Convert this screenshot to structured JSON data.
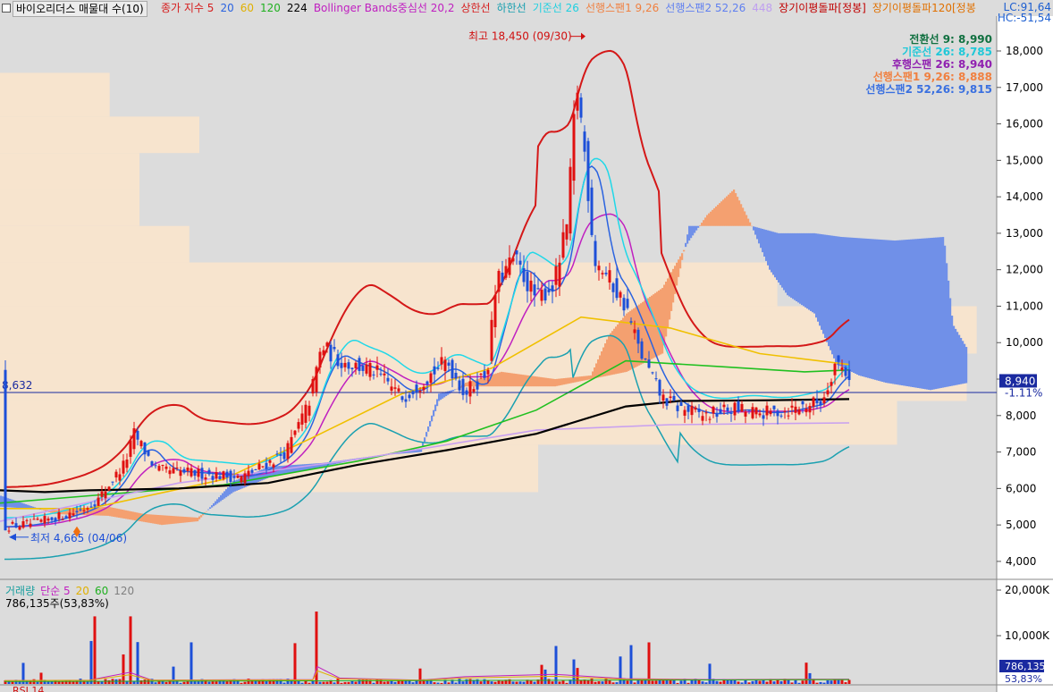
{
  "header": {
    "title": "바이오리더스 매물대 수(10)",
    "legend": [
      {
        "label": "종가 지수 5",
        "color": "#d62020"
      },
      {
        "label": "20",
        "color": "#2a63e0"
      },
      {
        "label": "60",
        "color": "#e0b000"
      },
      {
        "label": "120",
        "color": "#20b020"
      },
      {
        "label": "224",
        "color": "#000000"
      },
      {
        "label": "Bollinger Bands중심선 20,2",
        "color": "#c020c0"
      },
      {
        "label": "상한선",
        "color": "#d62020"
      },
      {
        "label": "하한선",
        "color": "#1aa0b0"
      },
      {
        "label": "기준선 26",
        "color": "#20d0e0"
      },
      {
        "label": "선행스팬1 9,26",
        "color": "#f08040"
      },
      {
        "label": "선행스팬2 52,26",
        "color": "#6080f0"
      },
      {
        "label": "448",
        "color": "#c0a0f0"
      },
      {
        "label": "장기이평돌파[정봉]",
        "color": "#c00000"
      },
      {
        "label": "장기이평돌파120[정봉",
        "color": "#e07000"
      }
    ],
    "lc": "LC:91,64",
    "hc": "HC:-51,54"
  },
  "ichimoku_readout": [
    {
      "label": "전환선 9: 8,990",
      "color": "#107040"
    },
    {
      "label": "기준선 26: 8,785",
      "color": "#20c8d8"
    },
    {
      "label": "후행스팬 26: 8,940",
      "color": "#9020b0"
    },
    {
      "label": "선행스팬1 9,26: 8,888",
      "color": "#f08040"
    },
    {
      "label": "선행스팬2 52,26: 9,815",
      "color": "#3a70e0"
    }
  ],
  "annotations": {
    "high": "최고 18,450 (09/30)",
    "low": "최저 4,665 (04/06)",
    "ref_level_label": "8,632",
    "price_tag": "8,940",
    "change_tag": "-1.11%"
  },
  "volume_panel": {
    "legend": [
      {
        "label": "거래량",
        "color": "#1a9f9f"
      },
      {
        "label": "단순 5",
        "color": "#c020c0"
      },
      {
        "label": "20",
        "color": "#e0b000"
      },
      {
        "label": "60",
        "color": "#20b020"
      },
      {
        "label": "120",
        "color": "#808080"
      }
    ],
    "readout": "786,135주(53,83%)",
    "tag_value": "786,135",
    "tag_pct": "53,83%",
    "ticks": [
      "20,000K",
      "10,000K"
    ]
  },
  "rsi_label": "RSI 14",
  "colors": {
    "up": "#e01010",
    "down": "#1d4fd8",
    "background": "#dcdcdc"
  },
  "chart_data": {
    "type": "candlestick",
    "y_ticks": [
      "18,000",
      "17,000",
      "16,000",
      "15,000",
      "14,000",
      "13,000",
      "12,000",
      "11,000",
      "10,000",
      "9,000",
      "8,000",
      "7,000",
      "6,000",
      "5,000",
      "4,000"
    ],
    "ylim": [
      3600,
      18900
    ],
    "ref_level": 8632,
    "last_close": 8940,
    "volume_profile": [
      {
        "lo": 4700,
        "hi": 5700,
        "w": 0.0
      },
      {
        "lo": 5900,
        "hi": 7200,
        "w": 0.54
      },
      {
        "lo": 7200,
        "hi": 8400,
        "w": 0.9
      },
      {
        "lo": 8400,
        "hi": 9700,
        "w": 0.97
      },
      {
        "lo": 9700,
        "hi": 11000,
        "w": 0.98
      },
      {
        "lo": 11000,
        "hi": 12200,
        "w": 0.78
      },
      {
        "lo": 12200,
        "hi": 13200,
        "w": 0.19
      },
      {
        "lo": 13200,
        "hi": 14200,
        "w": 0.14
      },
      {
        "lo": 14200,
        "hi": 15200,
        "w": 0.14
      },
      {
        "lo": 15200,
        "hi": 16200,
        "w": 0.2
      },
      {
        "lo": 16200,
        "hi": 17400,
        "w": 0.11
      }
    ],
    "series_anchor_points": {
      "ma224": [
        [
          0,
          5950
        ],
        [
          50,
          5900
        ],
        [
          100,
          5950
        ],
        [
          200,
          6000
        ],
        [
          300,
          6150
        ],
        [
          400,
          6650
        ],
        [
          500,
          7050
        ],
        [
          600,
          7500
        ],
        [
          700,
          8250
        ],
        [
          760,
          8400
        ],
        [
          860,
          8420
        ],
        [
          950,
          8450
        ]
      ],
      "ma120": [
        [
          0,
          5600
        ],
        [
          100,
          5800
        ],
        [
          250,
          6100
        ],
        [
          400,
          6750
        ],
        [
          500,
          7300
        ],
        [
          600,
          8150
        ],
        [
          700,
          9500
        ],
        [
          800,
          9350
        ],
        [
          900,
          9200
        ],
        [
          950,
          9250
        ]
      ],
      "ma60": [
        [
          0,
          5450
        ],
        [
          100,
          5450
        ],
        [
          250,
          6250
        ],
        [
          350,
          7400
        ],
        [
          450,
          8600
        ],
        [
          550,
          9300
        ],
        [
          650,
          10700
        ],
        [
          750,
          10400
        ],
        [
          850,
          9700
        ],
        [
          950,
          9400
        ]
      ],
      "ma448": [
        [
          0,
          5100
        ],
        [
          200,
          6150
        ],
        [
          400,
          6800
        ],
        [
          600,
          7600
        ],
        [
          750,
          7750
        ],
        [
          950,
          7800
        ]
      ]
    }
  }
}
